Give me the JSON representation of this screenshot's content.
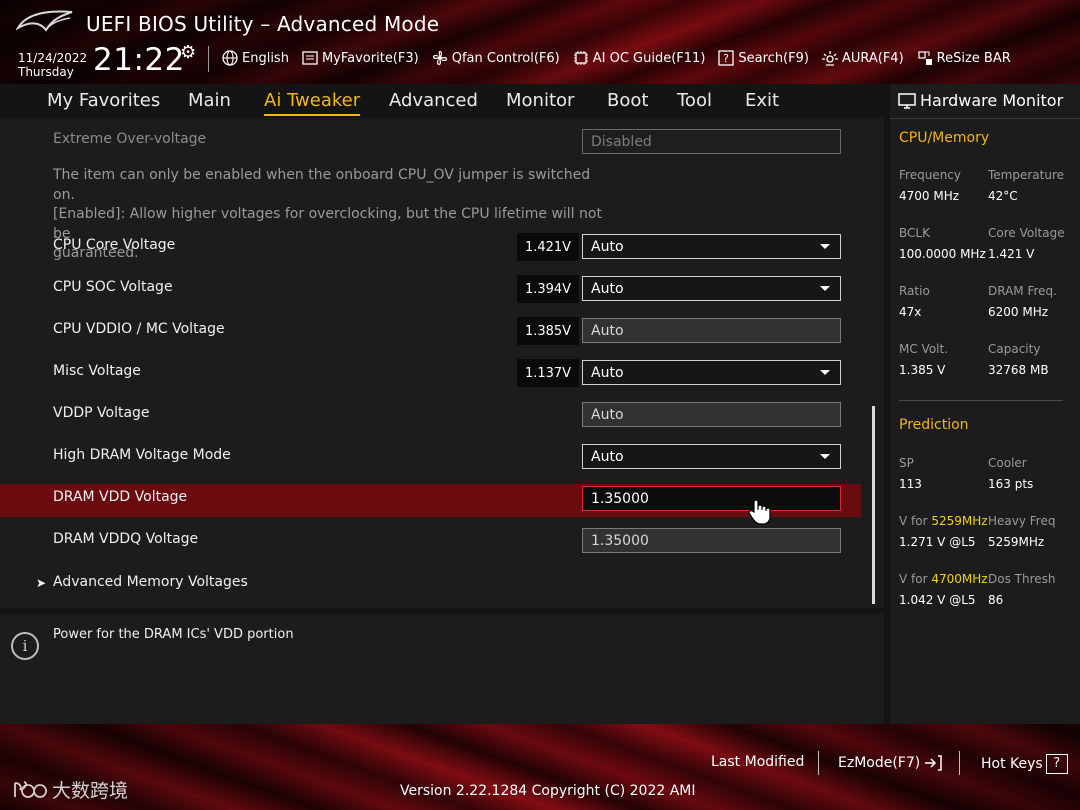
{
  "header": {
    "title": "UEFI BIOS Utility – Advanced Mode",
    "date": "11/24/2022",
    "day": "Thursday",
    "time": "21:22",
    "toolbar": [
      {
        "label": "English",
        "icon": "globe-icon"
      },
      {
        "label": "MyFavorite(F3)",
        "icon": "favorite-icon"
      },
      {
        "label": "Qfan Control(F6)",
        "icon": "fan-icon"
      },
      {
        "label": "AI OC Guide(F11)",
        "icon": "chip-icon"
      },
      {
        "label": "Search(F9)",
        "icon": "search-icon"
      },
      {
        "label": "AURA(F4)",
        "icon": "aura-icon"
      },
      {
        "label": "ReSize BAR",
        "icon": "resize-bar-icon"
      }
    ]
  },
  "tabs": [
    {
      "label": "My Favorites",
      "active": false
    },
    {
      "label": "Main",
      "active": false
    },
    {
      "label": "Ai Tweaker",
      "active": true
    },
    {
      "label": "Advanced",
      "active": false
    },
    {
      "label": "Monitor",
      "active": false
    },
    {
      "label": "Boot",
      "active": false
    },
    {
      "label": "Tool",
      "active": false
    },
    {
      "label": "Exit",
      "active": false
    }
  ],
  "settings": {
    "extreme": {
      "label": "Extreme Over-voltage",
      "value": "Disabled"
    },
    "note": [
      "The item can only be enabled when the onboard CPU_OV jumper is switched on.",
      "[Enabled]: Allow higher voltages for overclocking, but the CPU lifetime will not be",
      "guaranteed."
    ],
    "rows": [
      {
        "label": "CPU Core Voltage",
        "reading": "1.421V",
        "value": "Auto"
      },
      {
        "label": "CPU SOC Voltage",
        "reading": "1.394V",
        "value": "Auto"
      },
      {
        "label": "CPU VDDIO / MC Voltage",
        "reading": "1.385V",
        "value": "Auto"
      },
      {
        "label": "Misc Voltage",
        "reading": "1.137V",
        "value": "Auto"
      },
      {
        "label": "VDDP Voltage",
        "value": "Auto"
      },
      {
        "label": "High DRAM Voltage Mode",
        "value": "Auto"
      },
      {
        "label": "DRAM VDD Voltage",
        "value": "1.35000"
      },
      {
        "label": "DRAM VDDQ Voltage",
        "value": "1.35000"
      }
    ],
    "submenu": "Advanced Memory Voltages"
  },
  "info": {
    "text": "Power for the DRAM ICs' VDD portion"
  },
  "hardware_monitor": {
    "title": "Hardware Monitor",
    "cpu_memory": {
      "heading": "CPU/Memory",
      "items": [
        {
          "label": "Frequency",
          "value": "4700 MHz"
        },
        {
          "label": "Temperature",
          "value": "42°C"
        },
        {
          "label": "BCLK",
          "value": "100.0000 MHz"
        },
        {
          "label": "Core Voltage",
          "value": "1.421 V"
        },
        {
          "label": "Ratio",
          "value": "47x"
        },
        {
          "label": "DRAM Freq.",
          "value": "6200 MHz"
        },
        {
          "label": "MC Volt.",
          "value": "1.385 V"
        },
        {
          "label": "Capacity",
          "value": "32768 MB"
        }
      ]
    },
    "prediction": {
      "heading": "Prediction",
      "sp_label": "SP",
      "sp_value": "113",
      "cooler_label": "Cooler",
      "cooler_value": "163 pts",
      "vfor_prefix": "V for",
      "vfor1_freq": "5259MHz",
      "vfor1_value": "1.271 V @L5",
      "heavy_label": "Heavy Freq",
      "heavy_value": "5259MHz",
      "vfor2_freq": "4700MHz",
      "vfor2_value": "1.042 V @L5",
      "dos_label": "Dos Thresh",
      "dos_value": "86"
    }
  },
  "footer": {
    "last_modified": "Last Modified",
    "ezmode": "EzMode(F7)",
    "hotkeys": "Hot Keys",
    "hotkeys_key": "?",
    "version": "Version 2.22.1284 Copyright (C) 2022 AMI",
    "watermark": "大数跨境"
  },
  "colors": {
    "accent": "#f2b518",
    "highlight_row": "#6a0b10",
    "brand_red": "#8a0f15"
  }
}
